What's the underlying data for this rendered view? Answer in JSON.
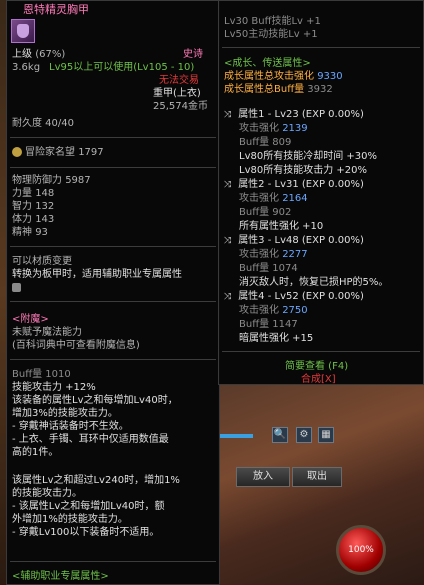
{
  "item": {
    "name": "恩特精灵胸甲",
    "grade": "上级",
    "grade_pct": "(67%)",
    "rarity": "史诗",
    "weight": "3.6kg",
    "level_req": "Lv95以上可以使用(Lv105 - 10)",
    "trade": "无法交易",
    "slot": "重甲(上衣)",
    "price": "25,574金币",
    "durability": "耐久度 40/40",
    "fame_label": "冒险家名望",
    "fame_value": "1797",
    "phys_def_label": "物理防御力",
    "phys_def_value": "5987",
    "stats": [
      {
        "label": "力量",
        "value": "148"
      },
      {
        "label": "智力",
        "value": "132"
      },
      {
        "label": "体力",
        "value": "143"
      },
      {
        "label": "精神",
        "value": "93"
      }
    ],
    "material_change": "可以材质变更",
    "convert_line": "转换为板甲时，适用辅助职业专属属性",
    "enchant_header": "<附魔>",
    "enchant_none": "未赋予魔法能力",
    "enchant_hint": "(百科词典中可查看附魔信息)",
    "buff_label": "Buff量",
    "buff_value": "1010",
    "effects_1": [
      "技能攻击力 +12%",
      "该装备的属性Lv之和每增加Lv40时，",
      "增加3%的技能攻击力。",
      "- 穿戴神话装备时不生效。",
      "- 上衣、手镯、耳环中仅适用数值最",
      "高的1件。"
    ],
    "effects_2": [
      "该属性Lv之和超过Lv240时，增加1%",
      "的技能攻击力。",
      "- 该属性Lv之和每增加Lv40时，额",
      "外增加1%的技能攻击力。",
      "- 穿戴Lv100以下装备时不适用。"
    ],
    "bottom_header": "<辅助职业专属属性>"
  },
  "growth": {
    "top_lines": [
      "Lv30 Buff技能Lv +1",
      "Lv50主动技能Lv +1"
    ],
    "header": "<成长、传送属性>",
    "total_atk_label": "成长属性总攻击强化",
    "total_atk_value": "9330",
    "total_buff_label": "成长属性总Buff量",
    "total_buff_value": "3932",
    "attributes": [
      {
        "title": "属性1 - Lv23 (EXP 0.00%)",
        "atk_label": "攻击强化",
        "atk": "2139",
        "buff_label": "Buff量",
        "buff": "809",
        "extra": [
          "Lv80所有技能冷却时间 +30%",
          "Lv80所有技能攻击力 +20%"
        ]
      },
      {
        "title": "属性2 - Lv31 (EXP 0.00%)",
        "atk_label": "攻击强化",
        "atk": "2164",
        "buff_label": "Buff量",
        "buff": "902",
        "extra": [
          "所有属性强化 +10"
        ]
      },
      {
        "title": "属性3 - Lv48 (EXP 0.00%)",
        "atk_label": "攻击强化",
        "atk": "2277",
        "buff_label": "Buff量",
        "buff": "1074",
        "extra": [
          "消灭敌人时，恢复已损HP的5%。"
        ]
      },
      {
        "title": "属性4 - Lv52 (EXP 0.00%)",
        "atk_label": "攻击强化",
        "atk": "2750",
        "buff_label": "Buff量",
        "buff": "1147",
        "extra": [
          "暗属性强化 +15"
        ]
      }
    ],
    "brief_view": "简要查看 (F4)",
    "synthesis": "合成[X]"
  },
  "toolbar": {
    "search_icon": "🔍",
    "gear_icon": "⚙",
    "grid_icon": "▦",
    "put_in_label": "放入",
    "take_out_label": "取出",
    "hp_percent": "100%"
  }
}
